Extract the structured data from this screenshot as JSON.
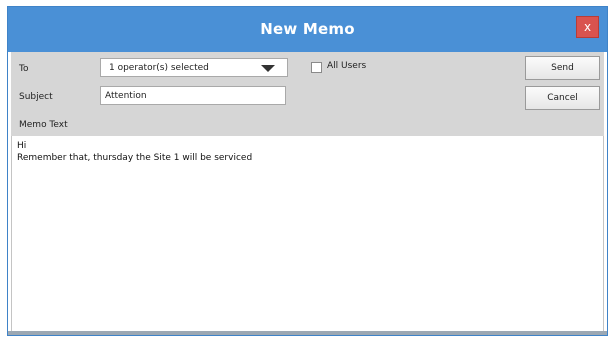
{
  "window": {
    "title": "New Memo",
    "close_glyph": "x",
    "title_bar_color": "#4a90d6",
    "close_color": "#d9534f"
  },
  "form": {
    "to_label": "To",
    "to_value": "1 operator(s) selected",
    "all_users_label": "All Users",
    "all_users_checked": false,
    "subject_label": "Subject",
    "subject_value": "Attention",
    "memo_text_label": "Memo Text"
  },
  "buttons": {
    "send": "Send",
    "cancel": "Cancel"
  },
  "memo": {
    "lines": [
      "Hi",
      "Remember that, thursday the Site 1 will be serviced"
    ]
  },
  "icons": {
    "dropdown": "caret-down-icon",
    "close": "close-icon"
  }
}
